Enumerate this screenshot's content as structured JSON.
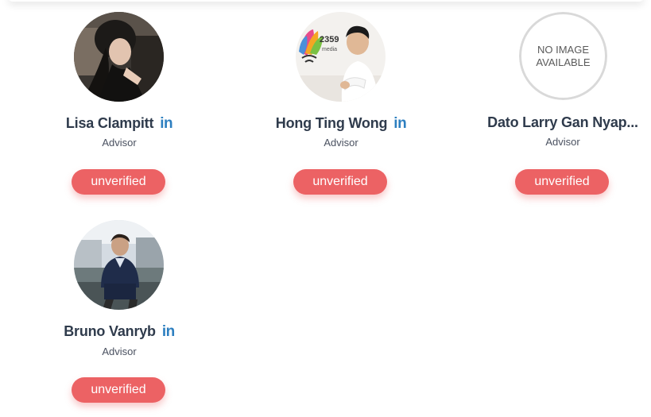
{
  "advisors": [
    {
      "name": "Lisa Clampitt",
      "role": "Advisor",
      "status": "unverified",
      "linkedin_icon": "linkedin-icon",
      "linkedin_text": "in"
    },
    {
      "name": "Hong Ting Wong",
      "role": "Advisor",
      "status": "unverified",
      "linkedin_icon": "linkedin-icon",
      "linkedin_text": "in",
      "photo_text": {
        "number": "2359",
        "word": "media"
      }
    },
    {
      "name": "Dato Larry Gan Nyap...",
      "role": "Advisor",
      "status": "unverified",
      "no_image": {
        "line1": "NO IMAGE",
        "line2": "AVAILABLE"
      }
    },
    {
      "name": "Bruno Vanryb",
      "role": "Advisor",
      "status": "unverified",
      "linkedin_icon": "linkedin-icon",
      "linkedin_text": "in"
    }
  ],
  "colors": {
    "name": "#2f3b4c",
    "linkedin": "#2d7fc0",
    "badge": "#ec6264",
    "role": "#4a5160"
  }
}
